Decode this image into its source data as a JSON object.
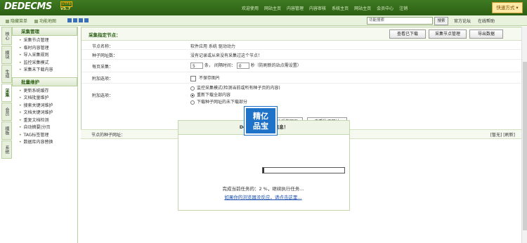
{
  "app": {
    "logo": "DEDECMS",
    "version": "v5.7",
    "badge": "UTF8"
  },
  "topnav": [
    "欢迎使用",
    "网站主页",
    "内容管理",
    "内容审核",
    "系统主页",
    "网站主页",
    "会员中心",
    "注销"
  ],
  "quick_select": "快速方式 ▾",
  "subbar": {
    "left_items": [
      "隐藏菜单",
      "功能地图"
    ],
    "search_value": "功能搜索",
    "search_button": "搜索",
    "links": [
      "官方论坛",
      "在线帮助"
    ]
  },
  "side_tabs": [
    "核心",
    "模块",
    "生成",
    "采集",
    "会员",
    "模板",
    "系统"
  ],
  "menu": {
    "group1": {
      "title": "采集管理",
      "items": [
        "采集节点管理",
        "临时内容管理",
        "导入采集规则",
        "监控采集模式",
        "采集未下载内容"
      ]
    },
    "group2": {
      "title": "批量维护",
      "items": [
        "更新系统缓存",
        "文档批量维护",
        "搜索关键词维护",
        "文档关键词维护",
        "重复文档检测",
        "自动摘要|分页",
        "TAG标签管理",
        "数据库内容替换"
      ]
    }
  },
  "panel": {
    "title": "采集指定节点：",
    "buttons": [
      "查看已下载",
      "采集节点管理",
      "导出数据"
    ],
    "node_label": "节点名称：",
    "node_value": "软件应用 系统 驱动动力",
    "seed_label": "种子网址数：",
    "seed_value": "没有记录或从来没有采集过这个节点！",
    "per_page_label": "每页采集：",
    "per_page_value": "5",
    "per_page_unit": "条，",
    "interval_label": "间隔时间：",
    "interval_value": "0",
    "interval_note": "秒（防刷新的站点需设置）",
    "special_label": "附加选项：",
    "special_option": "不保存图片",
    "extra_label": "附加选项：",
    "extra_options": [
      "监控采集模式(检测当前或所有种子页的内容)",
      "重新下载全部内容",
      "下载种子网址的未下载部分"
    ],
    "start_button": "开始采集网页",
    "view_button": "查看种子网址",
    "seed_bar_label": "节点的种子网址：",
    "seed_bar_right": "[暂无] [刷新]"
  },
  "dialog": {
    "title": "DedeCMS 提示信息！",
    "message": "完成当前任务的：2 %，继续执行任务...",
    "link": "如果你的浏览器没反应，请点击这里...",
    "progress": 0.02
  },
  "watermark": "精亿品宝"
}
